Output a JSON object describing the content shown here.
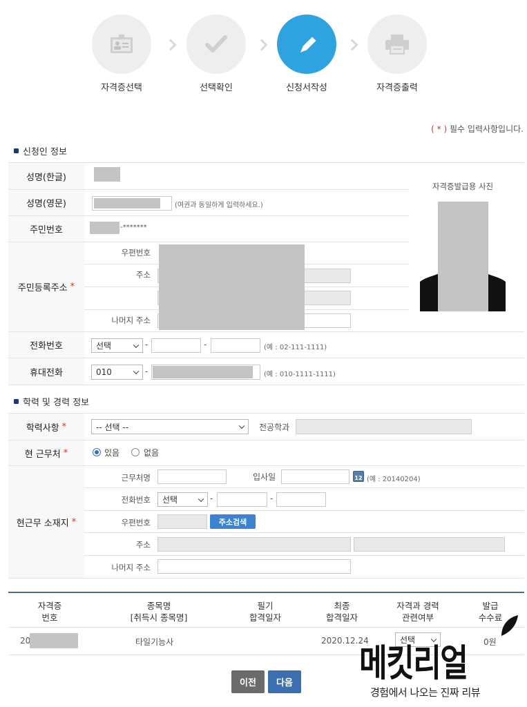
{
  "steps": [
    {
      "label": "자격증선택",
      "icon": "id-card-icon",
      "active": false
    },
    {
      "label": "선택확인",
      "icon": "checkmark-icon",
      "active": false
    },
    {
      "label": "신청서작성",
      "icon": "pencil-icon",
      "active": true
    },
    {
      "label": "자격증출력",
      "icon": "printer-icon",
      "active": false
    }
  ],
  "required_note": {
    "prefix": "( * )",
    "text": "필수 입력사항입니다."
  },
  "applicant_section": {
    "title": "신청인 정보",
    "name_kr_label": "성명(한글)",
    "name_en_label": "성명(영문)",
    "name_en_hint": "(여권과 동일하게 입력하세요.)",
    "rrn_label": "주민번호",
    "rrn_masked": "-*******",
    "address_label": "주민등록주소",
    "postal_label": "우편번호",
    "addr_label": "주소",
    "addr_rest_label": "나머지 주소",
    "phone_label": "전화번호",
    "phone_select": "선택",
    "phone_hint": "(예 : 02-111-1111)",
    "mobile_label": "휴대전화",
    "mobile_select": "010",
    "mobile_hint": "(예 : 010-1111-1111)",
    "photo_label": "자격증발급용 사진"
  },
  "career_section": {
    "title": "학력 및 경력 정보",
    "education_label": "학력사항",
    "education_select": "-- 선택 --",
    "major_label": "전공학과",
    "employer_label": "현 근무처",
    "employer_yes": "있음",
    "employer_no": "없음",
    "work_location_label": "현근무 소재지",
    "workplace_label": "근무처명",
    "hire_date_label": "입사일",
    "calendar_day": "12",
    "hire_date_hint": "(예 : 20140204)",
    "work_phone_label": "전화번호",
    "work_phone_select": "선택",
    "work_postal_label": "우편번호",
    "address_search_button": "주소검색",
    "work_addr_label": "주소",
    "work_addr_rest_label": "나머지 주소"
  },
  "table": {
    "headers": [
      [
        "자격증",
        "번호"
      ],
      [
        "종목명",
        "[취득시 종목명]"
      ],
      [
        "필기",
        "합격일자"
      ],
      [
        "최종",
        "합격일자"
      ],
      [
        "자격과 경력",
        "관련여부"
      ],
      [
        "발급",
        "수수료"
      ]
    ],
    "row": {
      "cert_no_prefix": "20",
      "item_name": "타일기능사",
      "final_pass_date": "2020.12.24",
      "related_select": "선택",
      "fee": "0원"
    }
  },
  "buttons": {
    "prev": "이전",
    "next": "다음"
  },
  "watermark": {
    "big": "메킷리얼",
    "small": "경험에서 나오는 진짜 리뷰"
  },
  "colors": {
    "accent": "#2ea3e0",
    "required": "#d9302f",
    "prev_button": "#6b6b6b",
    "next_button": "#3b6fb0"
  }
}
